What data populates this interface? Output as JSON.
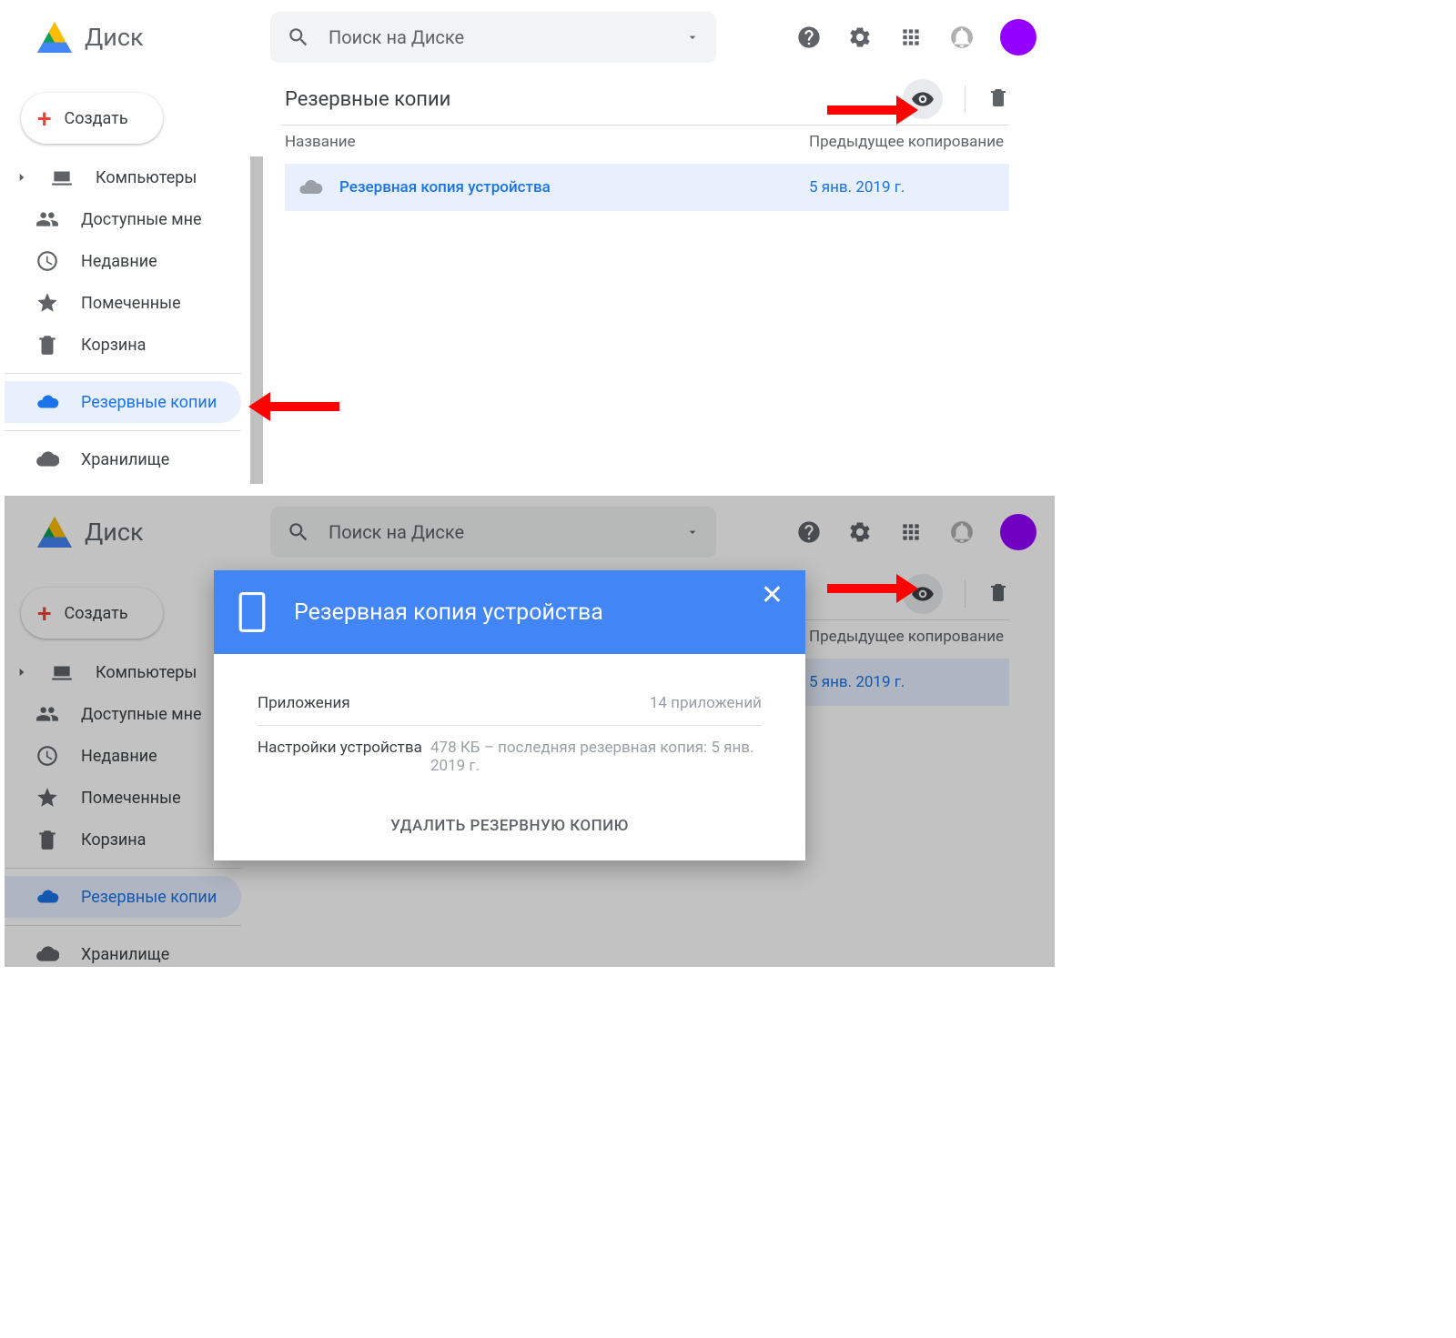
{
  "app_name": "Диск",
  "search": {
    "placeholder": "Поиск на Диске"
  },
  "create_label": "Создать",
  "section_title": "Резервные копии",
  "nav": {
    "computers": "Компьютеры",
    "shared": "Доступные мне",
    "recent": "Недавние",
    "starred": "Помеченные",
    "trash": "Корзина",
    "backups": "Резервные копии",
    "storage": "Хранилище"
  },
  "columns": {
    "name": "Название",
    "date": "Предыдущее копирование"
  },
  "rows": [
    {
      "name": "Резервная копия устройства",
      "date": "5 янв. 2019 г."
    }
  ],
  "dialog": {
    "title": "Резервная копия устройства",
    "apps_label": "Приложения",
    "apps_value": "14 приложений",
    "settings_label": "Настройки устройства",
    "settings_value": "478 КБ – последняя резервная копия: 5 янв. 2019 г.",
    "delete": "УДАЛИТЬ РЕЗЕРВНУЮ КОПИЮ"
  }
}
